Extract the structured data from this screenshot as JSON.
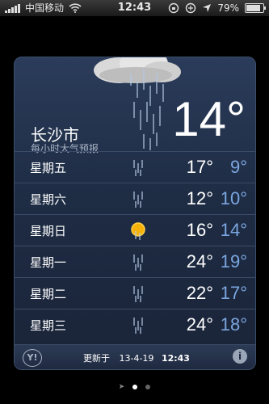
{
  "status_bar": {
    "carrier": "中国移动",
    "time": "12:43",
    "battery": "79%"
  },
  "weather": {
    "city": "长沙市",
    "subtitle": "每小时大气预报",
    "current_temp": "14°",
    "forecast": [
      {
        "day": "星期五",
        "hi": "17°",
        "lo": "9°",
        "icon": "rain-icon"
      },
      {
        "day": "星期六",
        "hi": "12°",
        "lo": "10°",
        "icon": "rain-icon"
      },
      {
        "day": "星期日",
        "hi": "16°",
        "lo": "14°",
        "icon": "sun-rain-icon"
      },
      {
        "day": "星期一",
        "hi": "24°",
        "lo": "19°",
        "icon": "rain-icon"
      },
      {
        "day": "星期二",
        "hi": "22°",
        "lo": "17°",
        "icon": "rain-icon"
      },
      {
        "day": "星期三",
        "hi": "24°",
        "lo": "18°",
        "icon": "rain-icon"
      }
    ],
    "footer": {
      "provider_icon": "yahoo-icon",
      "updated_label": "更新于",
      "updated_date": "13-4-19",
      "updated_time": "12:43"
    }
  },
  "colors": {
    "low_temp": "#7ba6e0",
    "card_bg": "#1e2c44"
  }
}
